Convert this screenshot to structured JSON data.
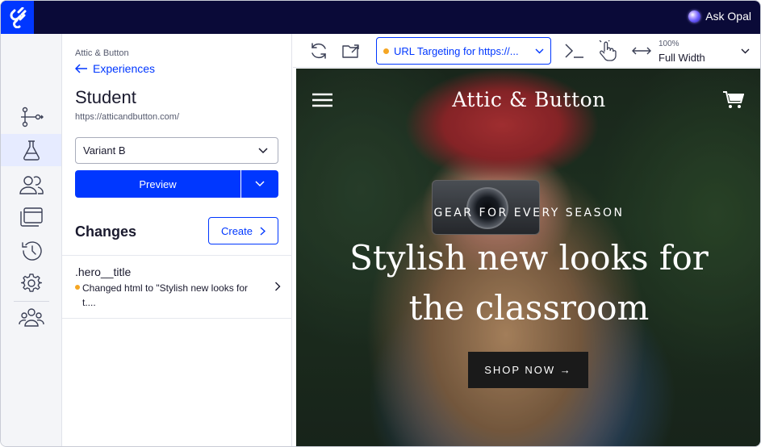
{
  "app": {
    "ask_opal": "Ask Opal"
  },
  "rail": {
    "items": [
      {
        "icon": "flow-icon"
      },
      {
        "icon": "flask-icon",
        "active": true
      },
      {
        "icon": "audiences-icon"
      },
      {
        "icon": "pages-icon"
      },
      {
        "icon": "history-icon"
      },
      {
        "icon": "gear-icon"
      },
      {
        "icon": "collaborators-icon"
      }
    ]
  },
  "panel": {
    "project_name": "Attic & Button",
    "back_label": "Experiences",
    "experience_title": "Student",
    "experience_url": "https://atticandbutton.com/",
    "variant_selected": "Variant B",
    "preview_label": "Preview",
    "changes_heading": "Changes",
    "create_label": "Create",
    "changes": [
      {
        "selector": ".hero__title",
        "description": "Changed html to \"Stylish new looks for t...."
      }
    ]
  },
  "toolbar": {
    "url_targeting": "URL Targeting for https://...",
    "zoom": "100%",
    "width_mode": "Full Width"
  },
  "site": {
    "logo": "Attic & Button",
    "eyebrow": "GEAR FOR EVERY SEASON",
    "hero_title": "Stylish new looks for the classroom",
    "cta": "SHOP NOW →"
  },
  "colors": {
    "brand_blue": "#0037ff",
    "topbar_navy": "#0a0a38",
    "status_orange": "#f5a623"
  }
}
